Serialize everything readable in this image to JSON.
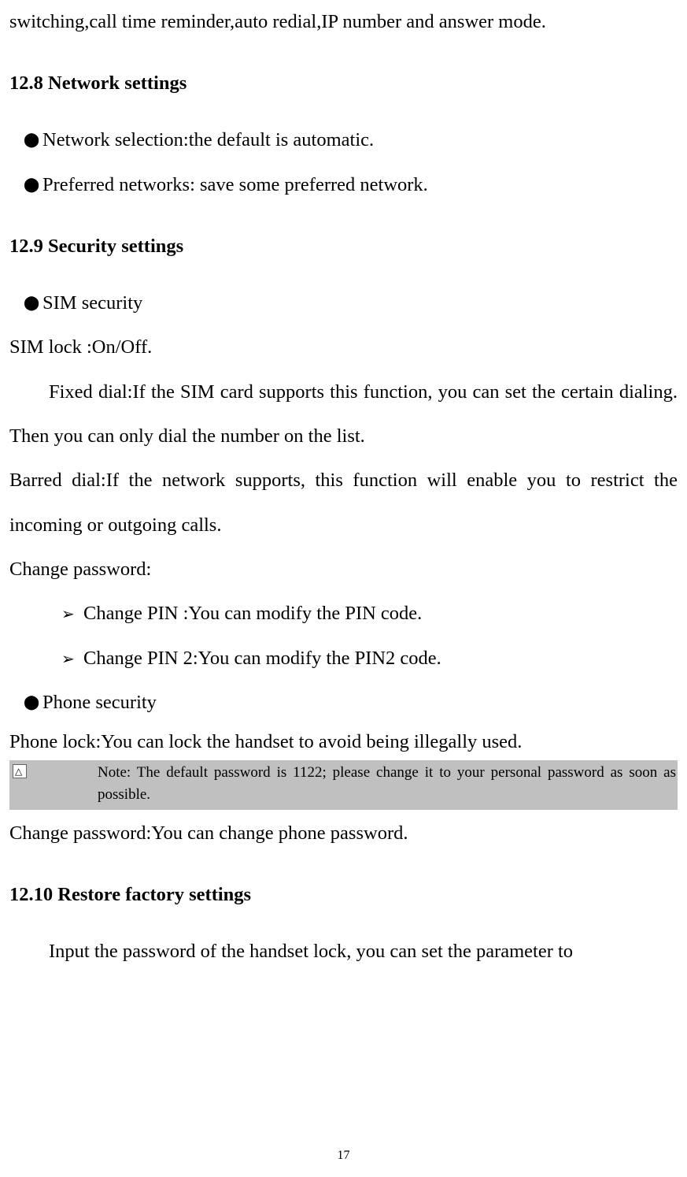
{
  "para_top": "switching,call time reminder,auto redial,IP number and answer mode.",
  "h_network": "12.8 Network settings",
  "network_b1": "Network selection:the default is automatic.",
  "network_b2": "Preferred networks: save some preferred network.",
  "h_security": "12.9 Security settings",
  "sec_b1": "SIM security",
  "sim_lock": "SIM lock :On/Off.",
  "fixed_dial": "Fixed dial:If the SIM card supports this function, you can set the certain dialing. Then you can only dial the number on the list.",
  "barred_dial": "Barred dial:If the network supports, this function will enable you to restrict the incoming or outgoing calls.",
  "change_pwd": "Change password:",
  "arrow1": "Change PIN :You can modify the PIN code.",
  "arrow2": "Change PIN 2:You can modify the PIN2 code.",
  "sec_b2": "Phone security",
  "phone_lock": "Phone lock:You can lock the handset to avoid being illegally used.",
  "note_text": "Note: The default password is 1122; please change it to your personal password as soon as possible.",
  "change_phone_pwd": "Change password:You can change phone password.",
  "h_restore": "12.10 Restore factory settings",
  "restore_para": "Input the password of the handset lock, you can set the parameter to",
  "page_number": "17"
}
